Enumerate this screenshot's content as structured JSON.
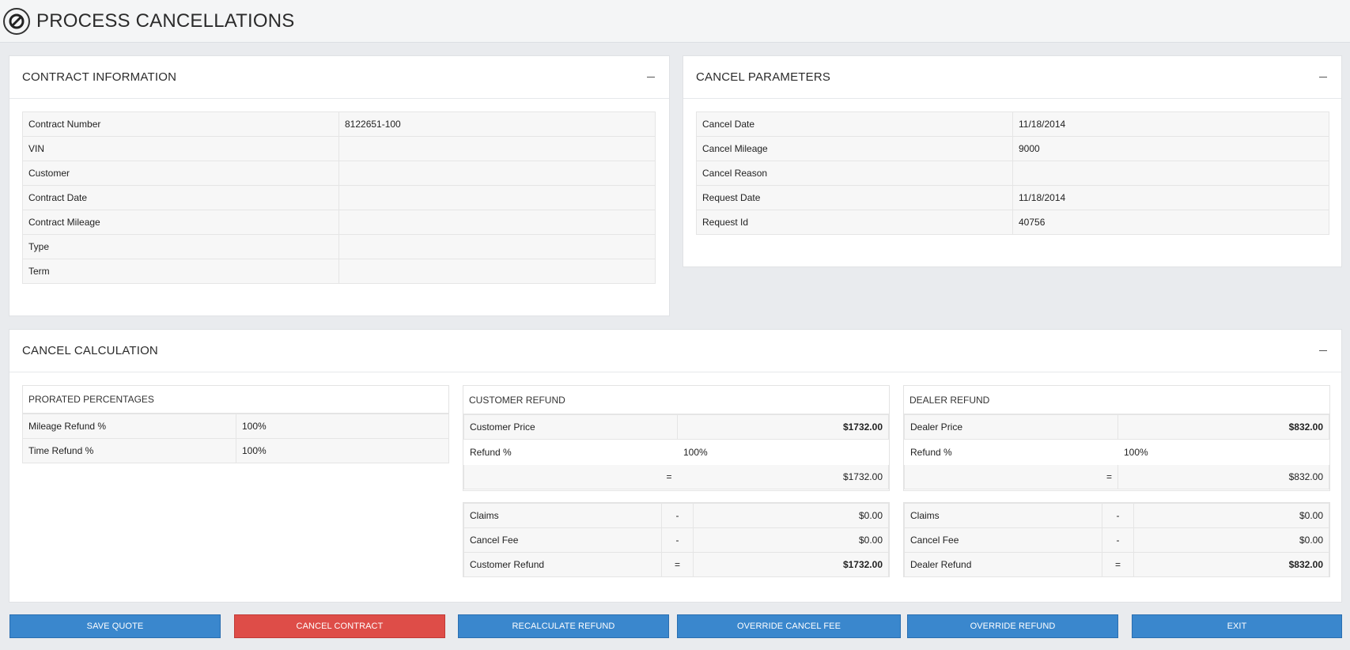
{
  "header": {
    "title": "PROCESS CANCELLATIONS",
    "icon": "ban-icon"
  },
  "contract_info": {
    "title": "CONTRACT INFORMATION",
    "rows": [
      {
        "label": "Contract Number",
        "value": "8122651-100"
      },
      {
        "label": "VIN",
        "value": ""
      },
      {
        "label": "Customer",
        "value": ""
      },
      {
        "label": "Contract Date",
        "value": ""
      },
      {
        "label": "Contract Mileage",
        "value": ""
      },
      {
        "label": "Type",
        "value": ""
      },
      {
        "label": "Term",
        "value": ""
      }
    ]
  },
  "cancel_params": {
    "title": "CANCEL PARAMETERS",
    "rows": [
      {
        "label": "Cancel Date",
        "value": "11/18/2014"
      },
      {
        "label": "Cancel Mileage",
        "value": "9000"
      },
      {
        "label": "Cancel Reason",
        "value": ""
      },
      {
        "label": "Request Date",
        "value": "11/18/2014"
      },
      {
        "label": "Request Id",
        "value": "40756"
      }
    ]
  },
  "cancel_calc": {
    "title": "CANCEL CALCULATION",
    "prorated": {
      "title": "PRORATED PERCENTAGES",
      "rows": [
        {
          "label": "Mileage Refund %",
          "value": "100%"
        },
        {
          "label": "Time Refund %",
          "value": "100%"
        }
      ]
    },
    "customer": {
      "title": "CUSTOMER REFUND",
      "price_label": "Customer Price",
      "price": "$1732.00",
      "refund_pct_label": "Refund %",
      "refund_pct": "100%",
      "eq": "=",
      "subtotal": "$1732.00",
      "claims_label": "Claims",
      "claims_sign": "-",
      "claims": "$0.00",
      "fee_label": "Cancel Fee",
      "fee_sign": "-",
      "fee": "$0.00",
      "refund_label": "Customer Refund",
      "refund_sign": "=",
      "refund": "$1732.00"
    },
    "dealer": {
      "title": "DEALER REFUND",
      "price_label": "Dealer Price",
      "price": "$832.00",
      "refund_pct_label": "Refund %",
      "refund_pct": "100%",
      "eq": "=",
      "subtotal": "$832.00",
      "claims_label": "Claims",
      "claims_sign": "-",
      "claims": "$0.00",
      "fee_label": "Cancel Fee",
      "fee_sign": "-",
      "fee": "$0.00",
      "refund_label": "Dealer Refund",
      "refund_sign": "=",
      "refund": "$832.00"
    }
  },
  "buttons": {
    "save_quote": "SAVE QUOTE",
    "cancel_contract": "CANCEL CONTRACT",
    "recalculate": "RECALCULATE REFUND",
    "override_fee": "OVERRIDE CANCEL FEE",
    "override_refund": "OVERRIDE REFUND",
    "exit": "EXIT"
  },
  "colors": {
    "primary": "#3a87cd",
    "danger": "#de4d48",
    "background": "#e9ebee"
  }
}
